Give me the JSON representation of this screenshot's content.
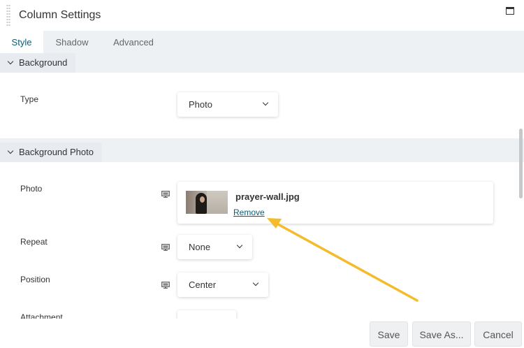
{
  "window": {
    "title": "Column Settings"
  },
  "tabs": [
    {
      "label": "Style",
      "active": true
    },
    {
      "label": "Shadow",
      "active": false
    },
    {
      "label": "Advanced",
      "active": false
    }
  ],
  "sections": {
    "background": {
      "title": "Background",
      "type_label": "Type",
      "type_value": "Photo"
    },
    "background_photo": {
      "title": "Background Photo",
      "photo_label": "Photo",
      "photo_filename": "prayer-wall.jpg",
      "remove_label": "Remove",
      "repeat_label": "Repeat",
      "repeat_value": "None",
      "position_label": "Position",
      "position_value": "Center",
      "attachment_label": "Attachment"
    }
  },
  "footer": {
    "save_label": "Save",
    "save_as_label": "Save As...",
    "cancel_label": "Cancel"
  },
  "colors": {
    "accent": "#0e5a71",
    "annotation_arrow": "#f4bc2a",
    "panel_bg": "#eef1f4"
  },
  "icons": {
    "drag": "grip-dots-icon",
    "maximize": "window-maximize-icon",
    "collapse": "chevron-down-icon",
    "dropdown": "chevron-down-icon",
    "responsive": "desktop-monitor-icon"
  }
}
